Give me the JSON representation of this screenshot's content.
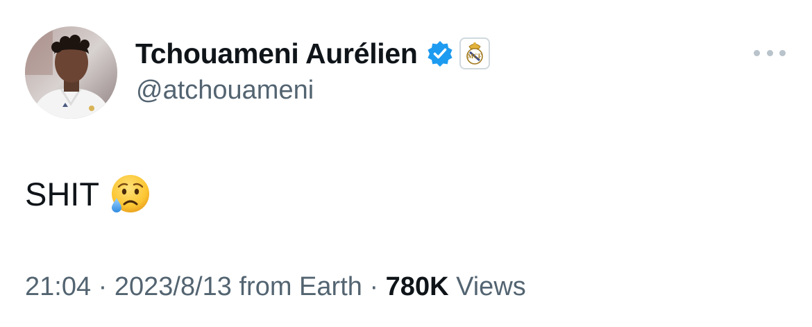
{
  "author": {
    "display_name": "Tchouameni Aurélien",
    "handle": "@atchouameni",
    "verified_color": "#1d9bf0",
    "avatar_icon": "profile-photo",
    "affiliate_badge_icon": "real-madrid-crest"
  },
  "tweet": {
    "text": "SHIT",
    "emoji": "😢",
    "emoji_icon": "crying-face-emoji"
  },
  "meta": {
    "time": "21:04",
    "separator": "·",
    "date": "2023/8/13",
    "source": "from Earth",
    "views_count": "780K",
    "views_label": "Views"
  },
  "menu": {
    "more_icon": "more-options-icon"
  },
  "colors": {
    "text_primary": "#0f1419",
    "text_secondary": "#536471",
    "verified_blue": "#1d9bf0",
    "more_dots": "#b9c3cb"
  }
}
